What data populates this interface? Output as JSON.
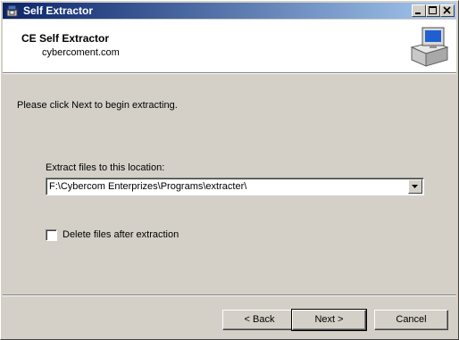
{
  "window": {
    "title": "Self Extractor"
  },
  "header": {
    "title": "CE Self Extractor",
    "subtitle": "cybercoment.com"
  },
  "body": {
    "intro": "Please click Next to begin extracting.",
    "location_label": "Extract files to this location:",
    "location_value": "F:\\Cybercom Enterprizes\\Programs\\extracter\\",
    "delete_label": "Delete files after extraction",
    "delete_checked": false
  },
  "buttons": {
    "back": "< Back",
    "next": "Next >",
    "cancel": "Cancel"
  },
  "icons": {
    "app": "package-icon",
    "header": "computer-box-icon",
    "minimize": "minimize-icon",
    "maximize": "maximize-icon",
    "close": "close-icon",
    "dropdown": "chevron-down-icon"
  },
  "colors": {
    "titlebar_start": "#0a246a",
    "titlebar_end": "#a6caf0",
    "face": "#d4d0c8"
  }
}
